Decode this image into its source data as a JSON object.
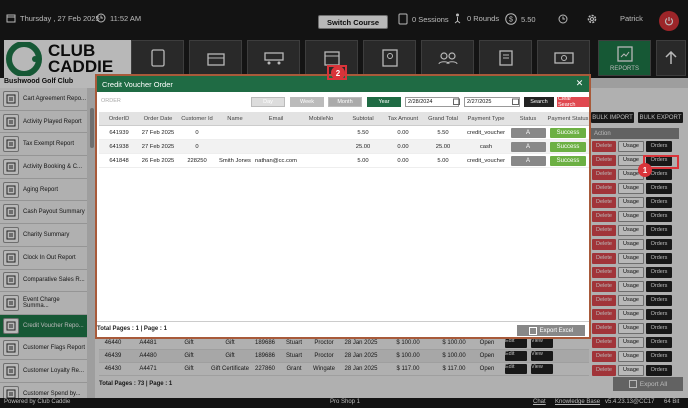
{
  "topbar": {
    "date": "Thursday , 27 Feb 2025",
    "time": "11:52 AM",
    "switch_course": "Switch Course",
    "sessions": "0 Sessions",
    "rounds": "0 Rounds",
    "balance": "5.50",
    "user": "Patrick"
  },
  "logo": {
    "line1": "CLUB",
    "line2": "CADDIE"
  },
  "club_name": "Bushwood Golf Club",
  "nav": {
    "reports_label": "REPORTS"
  },
  "sidebar": {
    "items": [
      {
        "label": "Cart Agreement Repo..."
      },
      {
        "label": "Activity Played Report"
      },
      {
        "label": "Tax Exempt Report"
      },
      {
        "label": "Activity Booking & C..."
      },
      {
        "label": "Aging Report"
      },
      {
        "label": "Cash Payout Summary"
      },
      {
        "label": "Charity Summary"
      },
      {
        "label": "Clock In Out Report"
      },
      {
        "label": "Comparative Sales R..."
      },
      {
        "label": "Event Charge Summa..."
      },
      {
        "label": "Credit Voucher Repo..."
      },
      {
        "label": "Customer Flags Report"
      },
      {
        "label": "Customer Loyalty Re..."
      },
      {
        "label": "Customer Spend by..."
      }
    ]
  },
  "bulk": {
    "import": "BULK IMPORT",
    "export": "BULK EXPORT"
  },
  "action_col": {
    "header": "Action",
    "delete": "Delete",
    "usage": "Usage",
    "orders": "Orders"
  },
  "bg_rows": [
    {
      "id": "46440",
      "num": "A4481",
      "type": "Gift",
      "desc": "Gift",
      "cust": "189686",
      "first": "Stuart",
      "last": "Proctor",
      "date": "28 Jan 2025",
      "amt": "$ 100.00",
      "amt2": "$ 100.00",
      "status": "Open"
    },
    {
      "id": "46439",
      "num": "A4480",
      "type": "Gift",
      "desc": "Gift",
      "cust": "189686",
      "first": "Stuart",
      "last": "Proctor",
      "date": "28 Jan 2025",
      "amt": "$ 100.00",
      "amt2": "$ 100.00",
      "status": "Open"
    },
    {
      "id": "46430",
      "num": "A4471",
      "type": "Gift",
      "desc": "Gift Certificate",
      "cust": "227860",
      "first": "Grant",
      "last": "Wingate",
      "date": "28 Jan 2025",
      "amt": "$ 117.00",
      "amt2": "$ 117.00",
      "status": "Open"
    }
  ],
  "bg_edit": "Edit",
  "bg_view": "View",
  "bg_pages": "Total Pages : 73 | Page : 1",
  "export_all": "Export All",
  "modal": {
    "title": "Credit Voucher Order",
    "order_label": "ORDER",
    "filters": {
      "day": "Day",
      "week": "Week",
      "month": "Month",
      "year": "Year"
    },
    "from_date": "2/28/2024",
    "to_date": "2/27/2025",
    "search": "Search",
    "clear_search": "Clear Search",
    "columns": [
      "OrderID",
      "Order Date",
      "Customer Id",
      "Name",
      "Email",
      "MobileNo",
      "Subtotal",
      "Tax Amount",
      "Grand Total",
      "Payment Type",
      "Status",
      "Payment Status"
    ],
    "rows": [
      {
        "order_id": "641939",
        "order_date": "27 Feb 2025",
        "customer_id": "0",
        "name": "",
        "email": "",
        "mobile": "",
        "subtotal": "5.50",
        "tax": "0.00",
        "grand_total": "5.50",
        "payment_type": "credit_voucher",
        "status": "A",
        "payment_status": "Success"
      },
      {
        "order_id": "641938",
        "order_date": "27 Feb 2025",
        "customer_id": "0",
        "name": "",
        "email": "",
        "mobile": "",
        "subtotal": "25.00",
        "tax": "0.00",
        "grand_total": "25.00",
        "payment_type": "cash",
        "status": "A",
        "payment_status": "Success"
      },
      {
        "order_id": "641848",
        "order_date": "26 Feb 2025",
        "customer_id": "228250",
        "name": "Smith Jones",
        "email": "nathan@cc.com",
        "mobile": "",
        "subtotal": "5.00",
        "tax": "0.00",
        "grand_total": "5.00",
        "payment_type": "credit_voucher",
        "status": "A",
        "payment_status": "Success"
      }
    ],
    "pages": "Total Pages : 1 | Page : 1",
    "export_excel": "Export Excel"
  },
  "badges": {
    "one": "1",
    "two": "2"
  },
  "footer": {
    "powered": "Powered by Club Caddie",
    "shop": "Pro Shop 1",
    "chat": "Chat",
    "kb": "Knowledge Base",
    "version": "v5.4.23.13@CC17",
    "bits": "64 Bit"
  },
  "colors": {
    "brand_green": "#1f6b44",
    "danger": "#d9343a",
    "success": "#6cb043"
  }
}
